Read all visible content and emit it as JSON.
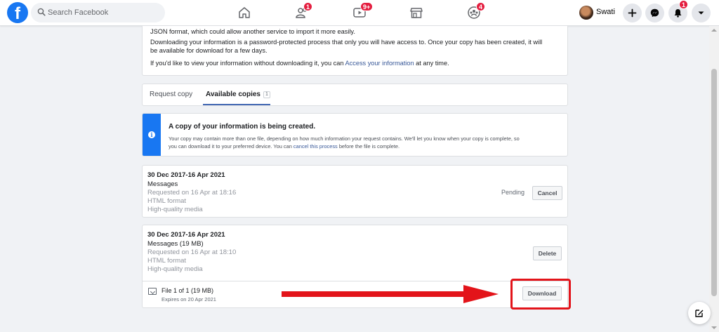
{
  "nav": {
    "logo_letter": "f",
    "search_placeholder": "Search Facebook",
    "friends_badge": "1",
    "watch_badge": "9+",
    "groups_badge": "4",
    "notifications_badge": "1",
    "profile_name": "Swati",
    "icons": [
      "home-icon",
      "friends-icon",
      "watch-icon",
      "marketplace-icon",
      "groups-icon",
      "plus-icon",
      "messenger-icon",
      "bell-icon",
      "caret-down-icon"
    ]
  },
  "intro": {
    "line1": "JSON format, which could allow another service to import it more easily.",
    "line2": "Downloading your information is a password-protected process that only you will have access to. Once your copy has been created, it will",
    "line3": "be available for download for a few days.",
    "line4_pre": "If you'd like to view your information without downloading it, you can ",
    "line4_link": "Access your information",
    "line4_post": " at any time."
  },
  "tabs": {
    "request_copy": "Request copy",
    "available_copies": "Available copies",
    "available_count": "1"
  },
  "notice": {
    "title": "A copy of your information is being created.",
    "body_line1": "Your copy may contain more than one file, depending on how much information your request contains. We'll let you know when your copy is complete, so",
    "body_pre": "you can download it to your preferred device. You can ",
    "body_link": "cancel this process",
    "body_post": " before the file is complete."
  },
  "requests": [
    {
      "range": "30 Dec 2017-16 Apr 2021",
      "type": "Messages",
      "requested": "Requested on 16 Apr at 18:16",
      "format": "HTML format",
      "quality": "High-quality media",
      "status": "Pending",
      "action": "Cancel"
    },
    {
      "range": "30 Dec 2017-16 Apr 2021",
      "type": "Messages (19 MB)",
      "requested": "Requested on 16 Apr at 18:10",
      "format": "HTML format",
      "quality": "High-quality media",
      "action": "Delete",
      "file_title": "File 1 of 1 (19 MB)",
      "file_expires": "Expires on 20 Apr 2021",
      "download": "Download"
    }
  ],
  "colors": {
    "brand_blue": "#1877f2",
    "link_blue": "#385898",
    "annotation_red": "#e3141a"
  }
}
